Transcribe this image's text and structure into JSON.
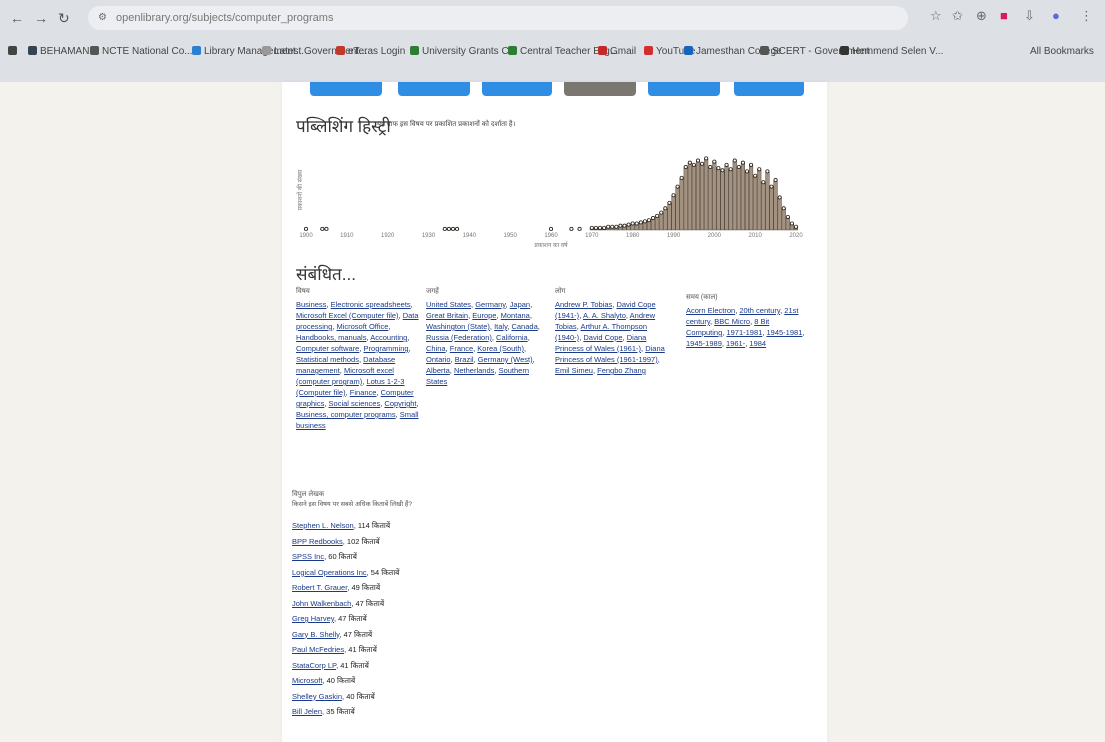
{
  "browser": {
    "url": "openlibrary.org/subjects/computer_programs",
    "bookmarks": [
      {
        "label": "",
        "color": "#444444"
      },
      {
        "label": "BEHAMAN",
        "color": "#334455"
      },
      {
        "label": "NCTE National Co...",
        "color": "#555555"
      },
      {
        "label": "Library Management...",
        "color": "#2a7fd0"
      },
      {
        "label": "Latest Government...",
        "color": "#999999"
      },
      {
        "label": "eTeras Login",
        "color": "#c0392b"
      },
      {
        "label": "University Grants C...",
        "color": "#2e7d32"
      },
      {
        "label": "Central Teacher Elig...",
        "color": "#2e7d32"
      },
      {
        "label": "Gmail",
        "color": "#c62828"
      },
      {
        "label": "YouTube",
        "color": "#d32f2f"
      },
      {
        "label": "Jamesthan College",
        "color": "#1565c0"
      },
      {
        "label": "SCERT - Government",
        "color": "#555555"
      },
      {
        "label": "Hemmend Selen V...",
        "color": "#333333"
      }
    ],
    "all_bookmarks": "All Bookmarks"
  },
  "publishing": {
    "title": "पब्लिशिंग हिस्ट्री",
    "subtitle": "यह ग्राफ इस विषय पर प्रकाशित प्रकाशनों को दर्शाता है।",
    "x_axis_label": "प्रकाशन का वर्ष",
    "y_axis_label": "प्रकाशनों की संख्या"
  },
  "chart_data": {
    "type": "bar",
    "title": "पब्लिशिंग हिस्ट्री",
    "xlabel": "प्रकाशन का वर्ष",
    "ylabel": "प्रकाशनों की संख्या",
    "x": [
      1900,
      1904,
      1905,
      1934,
      1935,
      1936,
      1937,
      1960,
      1965,
      1967,
      1970,
      1971,
      1972,
      1973,
      1974,
      1975,
      1976,
      1977,
      1978,
      1979,
      1980,
      1981,
      1982,
      1983,
      1984,
      1985,
      1986,
      1987,
      1988,
      1989,
      1990,
      1991,
      1992,
      1993,
      1994,
      1995,
      1996,
      1997,
      1998,
      1999,
      2000,
      2001,
      2002,
      2003,
      2004,
      2005,
      2006,
      2007,
      2008,
      2009,
      2010,
      2011,
      2012,
      2013,
      2014,
      2015,
      2016,
      2017,
      2018,
      2019,
      2020
    ],
    "values": [
      1,
      1,
      1,
      1,
      1,
      1,
      1,
      1,
      1,
      1,
      2,
      2,
      2,
      2,
      3,
      3,
      3,
      4,
      4,
      5,
      6,
      6,
      7,
      8,
      9,
      11,
      13,
      16,
      20,
      25,
      32,
      40,
      48,
      58,
      62,
      60,
      64,
      61,
      66,
      58,
      63,
      57,
      55,
      60,
      56,
      64,
      58,
      62,
      54,
      60,
      50,
      56,
      44,
      54,
      40,
      46,
      30,
      20,
      12,
      6,
      3
    ],
    "xlim": [
      1900,
      2020
    ],
    "ylim": [
      0,
      70
    ]
  },
  "related": {
    "title": "संबंधित...",
    "columns": [
      {
        "head": "विषय",
        "items": [
          "Business",
          "Electronic spreadsheets",
          "Microsoft Excel (Computer file)",
          "Data processing",
          "Microsoft Office",
          "Handbooks, manuals",
          "Accounting",
          "Computer software",
          "Programming",
          "Statistical methods",
          "Database management",
          "Microsoft excel (computer program)",
          "Lotus 1-2-3 (Computer file)",
          "Finance",
          "Computer graphics",
          "Social sciences",
          "Copyright",
          "Business, computer programs",
          "Small business"
        ]
      },
      {
        "head": "जगहें",
        "items": [
          "United States",
          "Germany",
          "Japan",
          "Great Britain",
          "Europe",
          "Montana",
          "Washington (State)",
          "Italy",
          "Canada",
          "Russia (Federation)",
          "California",
          "China",
          "France",
          "Korea (South)",
          "Ontario",
          "Brazil",
          "Germany (West)",
          "Alberta",
          "Netherlands",
          "Southern States"
        ]
      },
      {
        "head": "लोग",
        "items": [
          "Andrew P. Tobias",
          "David Cope (1941-)",
          "A. A. Shalyto",
          "Andrew Tobias",
          "Arthur A. Thompson (1940-)",
          "David Cope",
          "Diana Princess of Wales (1961-)",
          "Diana Princess of Wales (1961-1997)",
          "Emil Simeu",
          "Fengbo Zhang"
        ]
      },
      {
        "head": "समय (काल)",
        "items": [
          "Acorn Electron",
          "20th century",
          "21st century",
          "BBC Micro",
          "8 Bit Computing",
          "1971-1981",
          "1945-1981",
          "1945-1989",
          "1961-",
          "1984"
        ]
      }
    ]
  },
  "prolific": {
    "head": "विपुल लेखक",
    "sub": "किसने इस विषय पर सबसे अधिक किताबें लिखी हैं?",
    "suffix": "किताबें",
    "authors": [
      {
        "name": "Stephen L. Nelson",
        "count": "114"
      },
      {
        "name": "BPP Redbooks",
        "count": "102"
      },
      {
        "name": "SPSS Inc",
        "count": "60"
      },
      {
        "name": "Logical Operations Inc",
        "count": "54"
      },
      {
        "name": "Robert T. Grauer",
        "count": "49"
      },
      {
        "name": "John Walkenbach",
        "count": "47"
      },
      {
        "name": "Greg Harvey",
        "count": "47"
      },
      {
        "name": "Gary B. Shelly",
        "count": "47"
      },
      {
        "name": "Paul McFedries",
        "count": "41"
      },
      {
        "name": "StataCorp LP",
        "count": "41"
      },
      {
        "name": "Microsoft",
        "count": "40"
      },
      {
        "name": "Shelley Gaskin",
        "count": "40"
      },
      {
        "name": "Bill Jelen",
        "count": "35"
      }
    ]
  }
}
